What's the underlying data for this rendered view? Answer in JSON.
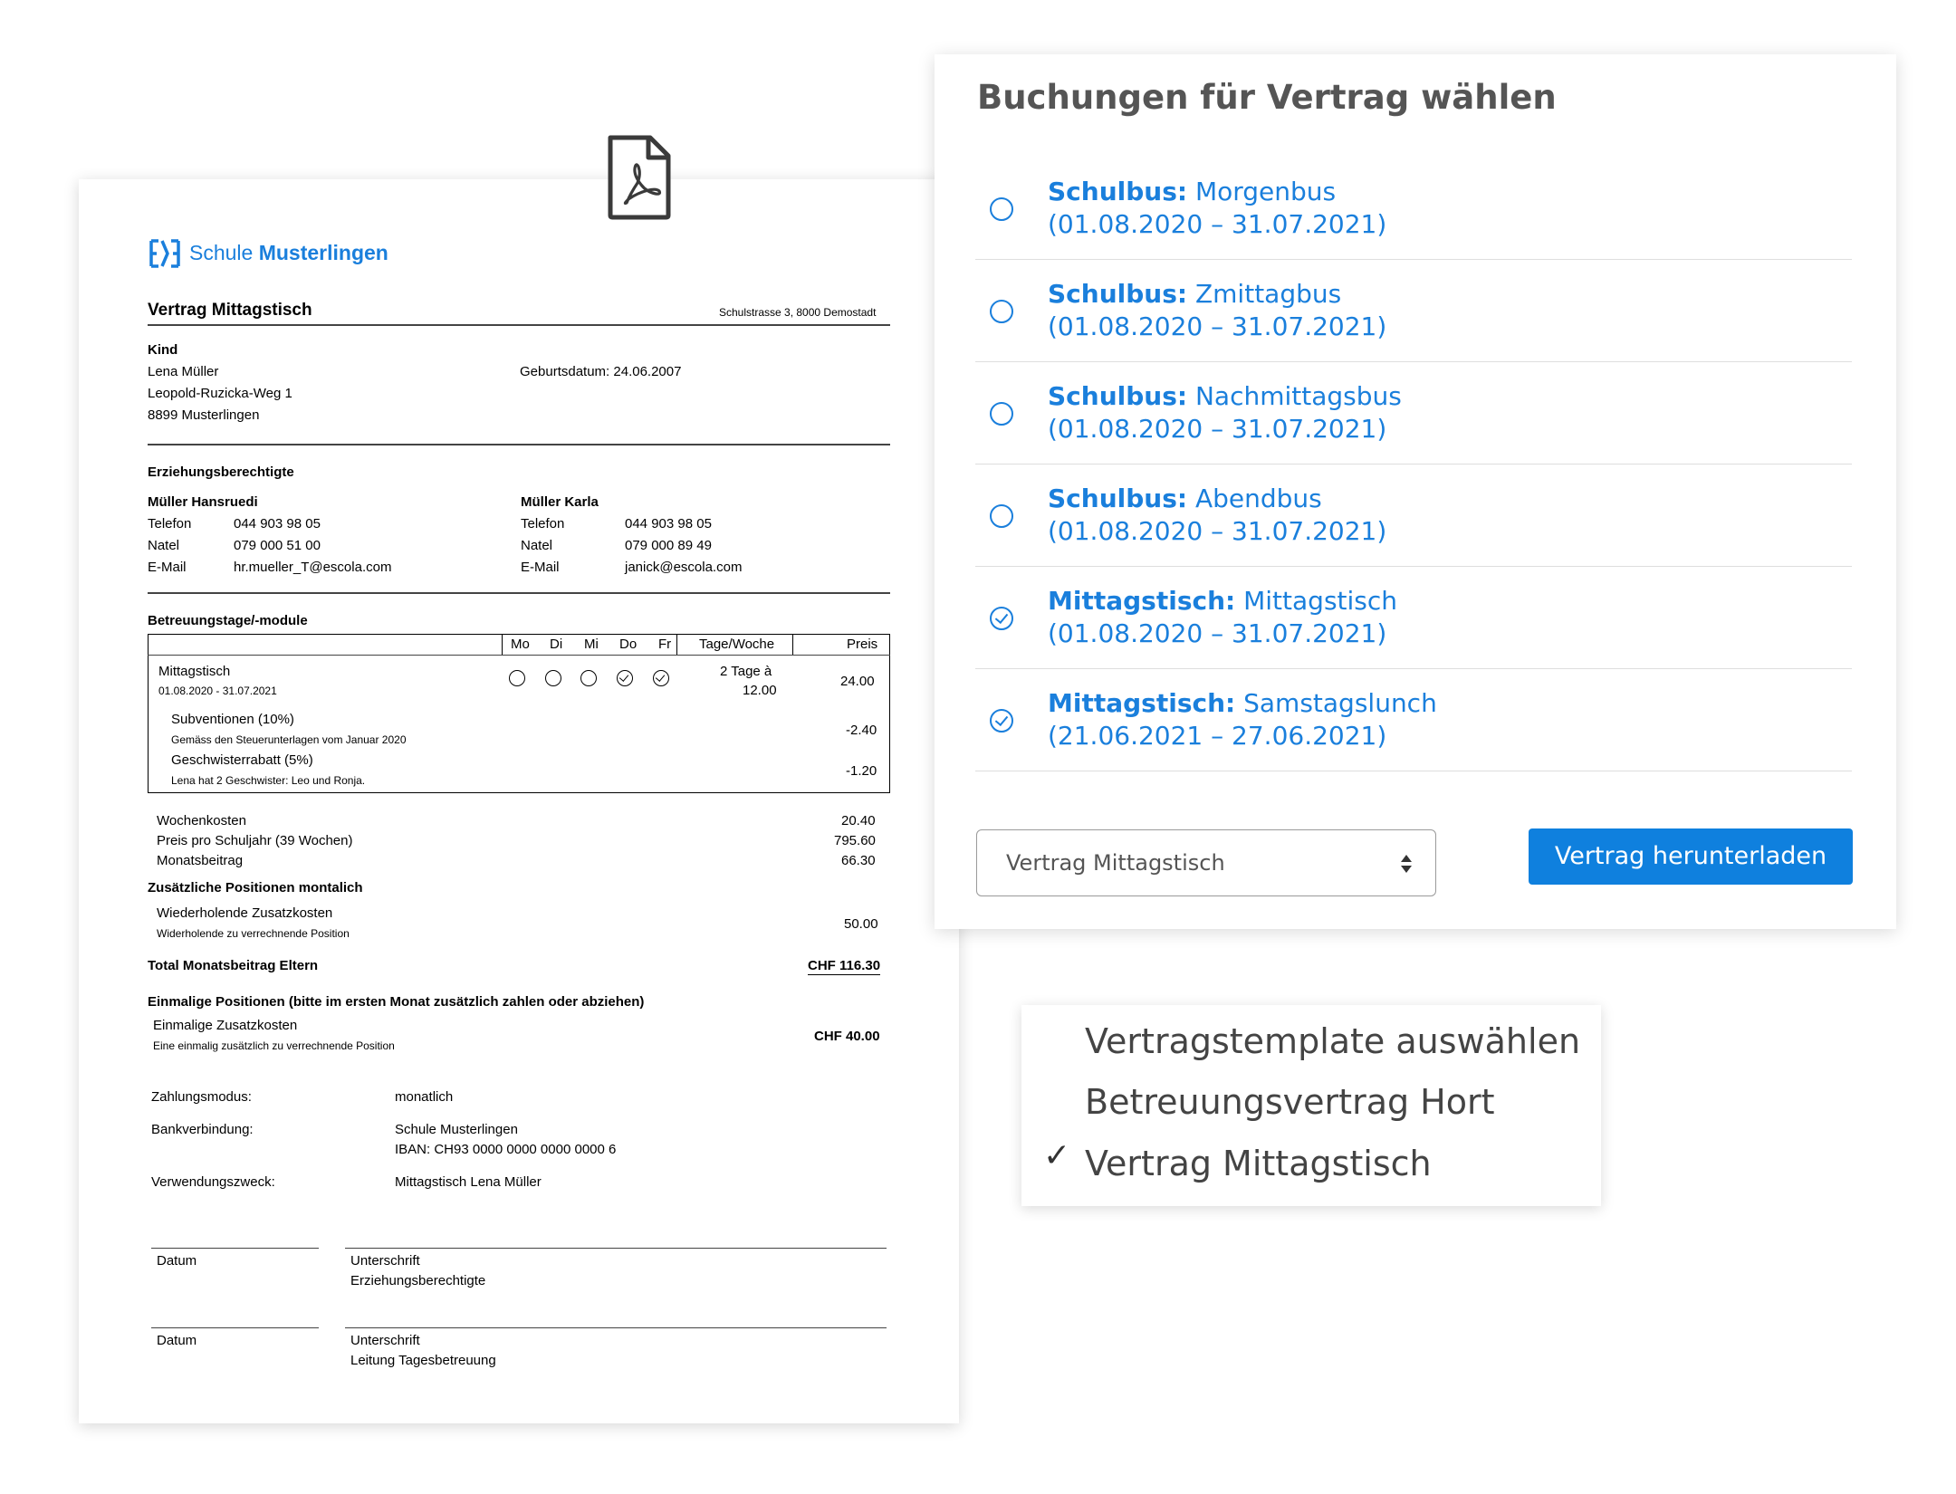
{
  "document": {
    "logo_prefix": "Schule ",
    "logo_bold": "Musterlingen",
    "title": "Vertrag Mittagstisch",
    "address": "Schulstrasse 3, 8000 Demostadt",
    "kind": {
      "heading": "Kind",
      "name": "Lena Müller",
      "street": "Leopold-Ruzicka-Weg 1",
      "city": "8899 Musterlingen",
      "birth": "Geburtsdatum: 24.06.2007"
    },
    "guardians": {
      "heading": "Erziehungsberechtigte",
      "g1": {
        "name": "Müller Hansruedi",
        "tel_label": "Telefon",
        "tel": "044 903 98 05",
        "natel_label": "Natel",
        "natel": "079 000 51 00",
        "mail_label": "E-Mail",
        "mail": "hr.mueller_T@escola.com"
      },
      "g2": {
        "name": "Müller Karla",
        "tel_label": "Telefon",
        "tel": "044 903 98 05",
        "natel_label": "Natel",
        "natel": "079 000 89 49",
        "mail_label": "E-Mail",
        "mail": "janick@escola.com"
      }
    },
    "modules": {
      "heading": "Betreuungstage/-module",
      "days": [
        "Mo",
        "Di",
        "Mi",
        "Do",
        "Fr"
      ],
      "days_checked": [
        false,
        false,
        false,
        true,
        true
      ],
      "col_tage": "Tage/Woche",
      "col_preis": "Preis",
      "row_name": "Mittagstisch",
      "row_dates": "01.08.2020 - 31.07.2021",
      "row_tage_1": "2 Tage à",
      "row_tage_2": "12.00",
      "row_price": "24.00",
      "sub1_name": "Subventionen (10%)",
      "sub1_note": "Gemäss den Steuerunterlagen vom Januar 2020",
      "sub1_price": "-2.40",
      "sub2_name": "Geschwisterrabatt (5%)",
      "sub2_note": "Lena hat 2 Geschwister: Leo und Ronja.",
      "sub2_price": "-1.20"
    },
    "totals": {
      "week_label": "Wochenkosten",
      "week_value": "20.40",
      "year_label": "Preis pro Schuljahr (39 Wochen)",
      "year_value": "795.60",
      "month_label": "Monatsbeitrag",
      "month_value": "66.30"
    },
    "extra_monthly": {
      "heading": "Zusätzliche Positionen montalich",
      "name": "Wiederholende Zusatzkosten",
      "note": "Widerholende zu verrechnende Position",
      "value": "50.00"
    },
    "total": {
      "label": "Total Monatsbeitrag Eltern",
      "value": "CHF 116.30"
    },
    "one_time": {
      "heading": "Einmalige Positionen (bitte im ersten Monat zusätzlich zahlen oder abziehen)",
      "name": "Einmalige Zusatzkosten",
      "note": "Eine einmalig zusätzlich zu verrechnende Position",
      "value": "CHF 40.00"
    },
    "payment": {
      "mode_label": "Zahlungsmodus:",
      "mode_value": "monatlich",
      "bank_label": "Bankverbindung:",
      "bank_value_1": "Schule Musterlingen",
      "bank_value_2": "IBAN: CH93 0000 0000 0000 0000 6",
      "purpose_label": "Verwendungszweck:",
      "purpose_value": "Mittagstisch Lena Müller"
    },
    "signatures": {
      "date_label": "Datum",
      "sig_label": "Unterschrift",
      "sig1_role": "Erziehungsberechtigte",
      "sig2_role": "Leitung Tagesbetreuung"
    }
  },
  "icons": {
    "file": "pdf-file-icon",
    "dropdown": "sort-arrows-icon",
    "check": "checkmark-icon"
  },
  "booking_card": {
    "title": "Buchungen für Vertrag wählen",
    "items": [
      {
        "category": "Schulbus:",
        "name": " Morgenbus",
        "dates": "(01.08.2020 – 31.07.2021)",
        "selected": false
      },
      {
        "category": "Schulbus:",
        "name": " Zmittagbus",
        "dates": "(01.08.2020 – 31.07.2021)",
        "selected": false
      },
      {
        "category": "Schulbus:",
        "name": " Nachmittagsbus",
        "dates": "(01.08.2020 – 31.07.2021)",
        "selected": false
      },
      {
        "category": "Schulbus:",
        "name": " Abendbus",
        "dates": "(01.08.2020 – 31.07.2021)",
        "selected": false
      },
      {
        "category": "Mittagstisch:",
        "name": " Mittagstisch",
        "dates": "(01.08.2020 – 31.07.2021)",
        "selected": true
      },
      {
        "category": "Mittagstisch:",
        "name": " Samstagslunch",
        "dates": "(21.06.2021 – 27.06.2021)",
        "selected": true
      }
    ],
    "select_value": "Vertrag Mittagstisch",
    "download_label": "Vertrag herunterladen"
  },
  "template_menu": {
    "options": [
      "Vertragstemplate auswählen",
      "Betreuungsvertrag Hort",
      "Vertrag Mittagstisch"
    ],
    "selected_index": 2,
    "check_mark": "✓"
  },
  "colors": {
    "accent": "#1a7fdc",
    "button": "#0f80de",
    "heading_gray": "#555555"
  }
}
